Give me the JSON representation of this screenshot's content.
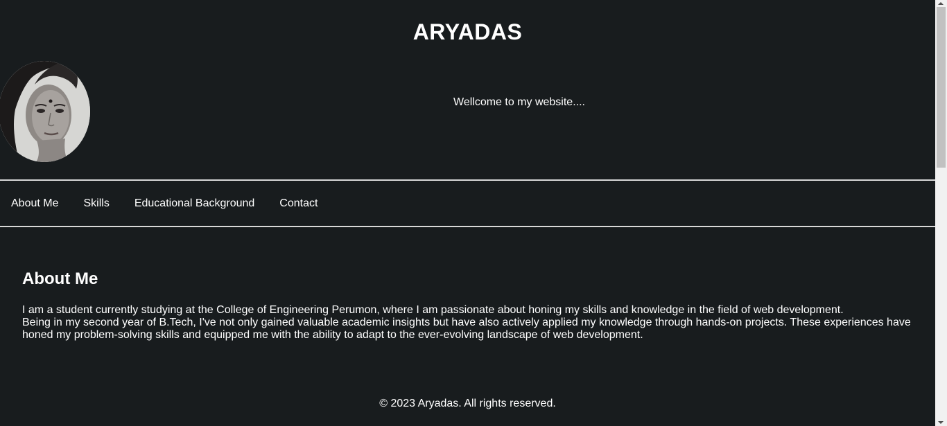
{
  "header": {
    "title": "ARYADAS",
    "welcome": "Wellcome to my website...."
  },
  "avatar": {
    "icon": "profile-photo"
  },
  "nav": {
    "items": [
      {
        "label": "About Me"
      },
      {
        "label": "Skills"
      },
      {
        "label": "Educational Background"
      },
      {
        "label": "Contact"
      }
    ]
  },
  "about": {
    "heading": "About Me",
    "line1": "I am a student currently studying at the College of Engineering Perumon, where I am passionate about honing my skills and knowledge in the field of web development.",
    "line2": "Being in my second year of B.Tech, I've not only gained valuable academic insights but have also actively applied my knowledge through hands-on projects. These experiences have honed my problem-solving skills and equipped me with the ability to adapt to the ever-evolving landscape of web development."
  },
  "footer": {
    "text": "© 2023 Aryadas. All rights reserved."
  },
  "colors": {
    "background": "#181c1e",
    "text": "#ffffff",
    "divider": "#d8d8d8"
  }
}
